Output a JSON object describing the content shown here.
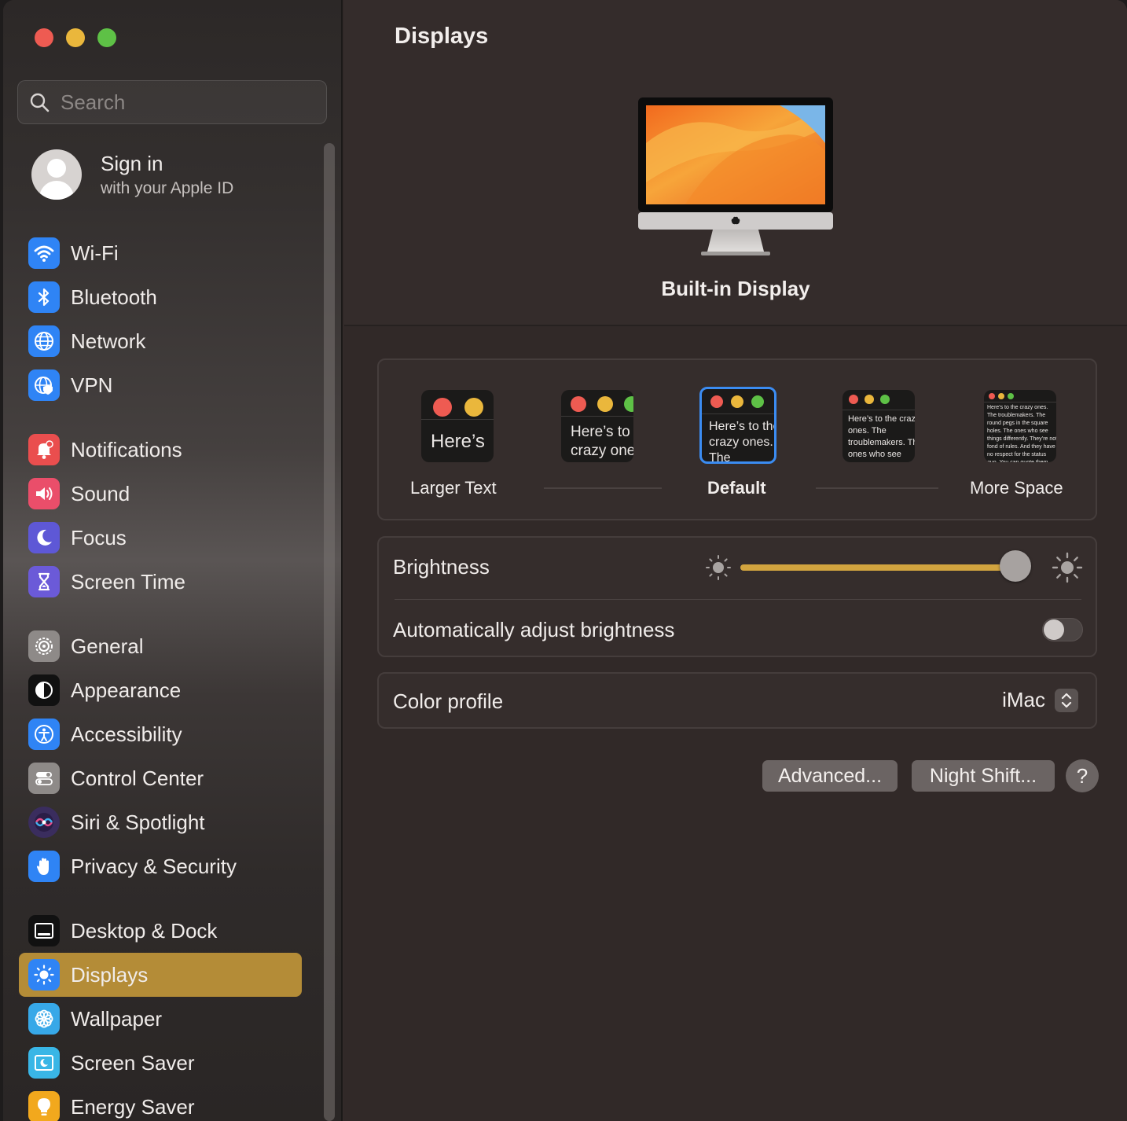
{
  "window": {
    "title": "Displays"
  },
  "search": {
    "placeholder": "Search"
  },
  "account": {
    "title": "Sign in",
    "subtitle": "with your Apple ID"
  },
  "sidebar": {
    "items": [
      {
        "label": "Wi-Fi",
        "icon": "wifi-icon",
        "color": "#2f84f5"
      },
      {
        "label": "Bluetooth",
        "icon": "bluetooth-icon",
        "color": "#2f84f5"
      },
      {
        "label": "Network",
        "icon": "globe-icon",
        "color": "#2f84f5"
      },
      {
        "label": "VPN",
        "icon": "vpn-globe-icon",
        "color": "#2f84f5"
      },
      {
        "label": "Notifications",
        "icon": "bell-icon",
        "color": "#ea4e4e"
      },
      {
        "label": "Sound",
        "icon": "speaker-icon",
        "color": "#ea4e6a"
      },
      {
        "label": "Focus",
        "icon": "moon-icon",
        "color": "#5e58d6"
      },
      {
        "label": "Screen Time",
        "icon": "hourglass-icon",
        "color": "#6b5ad8"
      },
      {
        "label": "General",
        "icon": "gear-icon",
        "color": "#8e8a88"
      },
      {
        "label": "Appearance",
        "icon": "appearance-icon",
        "color": "#111111"
      },
      {
        "label": "Accessibility",
        "icon": "accessibility-icon",
        "color": "#2f84f5"
      },
      {
        "label": "Control Center",
        "icon": "toggles-icon",
        "color": "#8e8a88"
      },
      {
        "label": "Siri & Spotlight",
        "icon": "siri-icon",
        "color": "#3a2d5e"
      },
      {
        "label": "Privacy & Security",
        "icon": "hand-icon",
        "color": "#2f84f5"
      },
      {
        "label": "Desktop & Dock",
        "icon": "dock-icon",
        "color": "#111111"
      },
      {
        "label": "Displays",
        "icon": "sun-icon",
        "color": "#2f84f5"
      },
      {
        "label": "Wallpaper",
        "icon": "flower-icon",
        "color": "#37a8e8"
      },
      {
        "label": "Screen Saver",
        "icon": "screensaver-icon",
        "color": "#39b6e6"
      },
      {
        "label": "Energy Saver",
        "icon": "bulb-icon",
        "color": "#f2a81d"
      }
    ],
    "selected": "Displays",
    "accent": "#b48c37"
  },
  "display": {
    "name": "Built-in Display"
  },
  "resolution": {
    "options": [
      {
        "preview": "Here’s",
        "label": "Larger Text"
      },
      {
        "preview": "Here’s to the crazy ones. The troublemakers."
      },
      {
        "preview": "Here’s to the crazy ones. The troublemakers. The ones who",
        "label": "Default",
        "selected": true
      },
      {
        "preview": "Here’s to the crazy ones. The troublemakers. The ones who see things differently. They’re not fond of rules. And they"
      },
      {
        "preview": "Here’s to the crazy ones. The troublemakers. The round pegs in the square holes. The ones who see things differently. They’re not fond of rules. And they have no respect for the status quo. You can quote them, disagree with them. About the only thing you can’t do is ignore them. Because they change things.",
        "label": "More Space"
      }
    ]
  },
  "brightness": {
    "label": "Brightness",
    "value": 0.95,
    "accent": "#d2a43f"
  },
  "auto_brightness": {
    "label": "Automatically adjust brightness",
    "on": false
  },
  "color_profile": {
    "label": "Color profile",
    "value": "iMac"
  },
  "buttons": {
    "advanced": "Advanced...",
    "night_shift": "Night Shift...",
    "help": "?"
  }
}
